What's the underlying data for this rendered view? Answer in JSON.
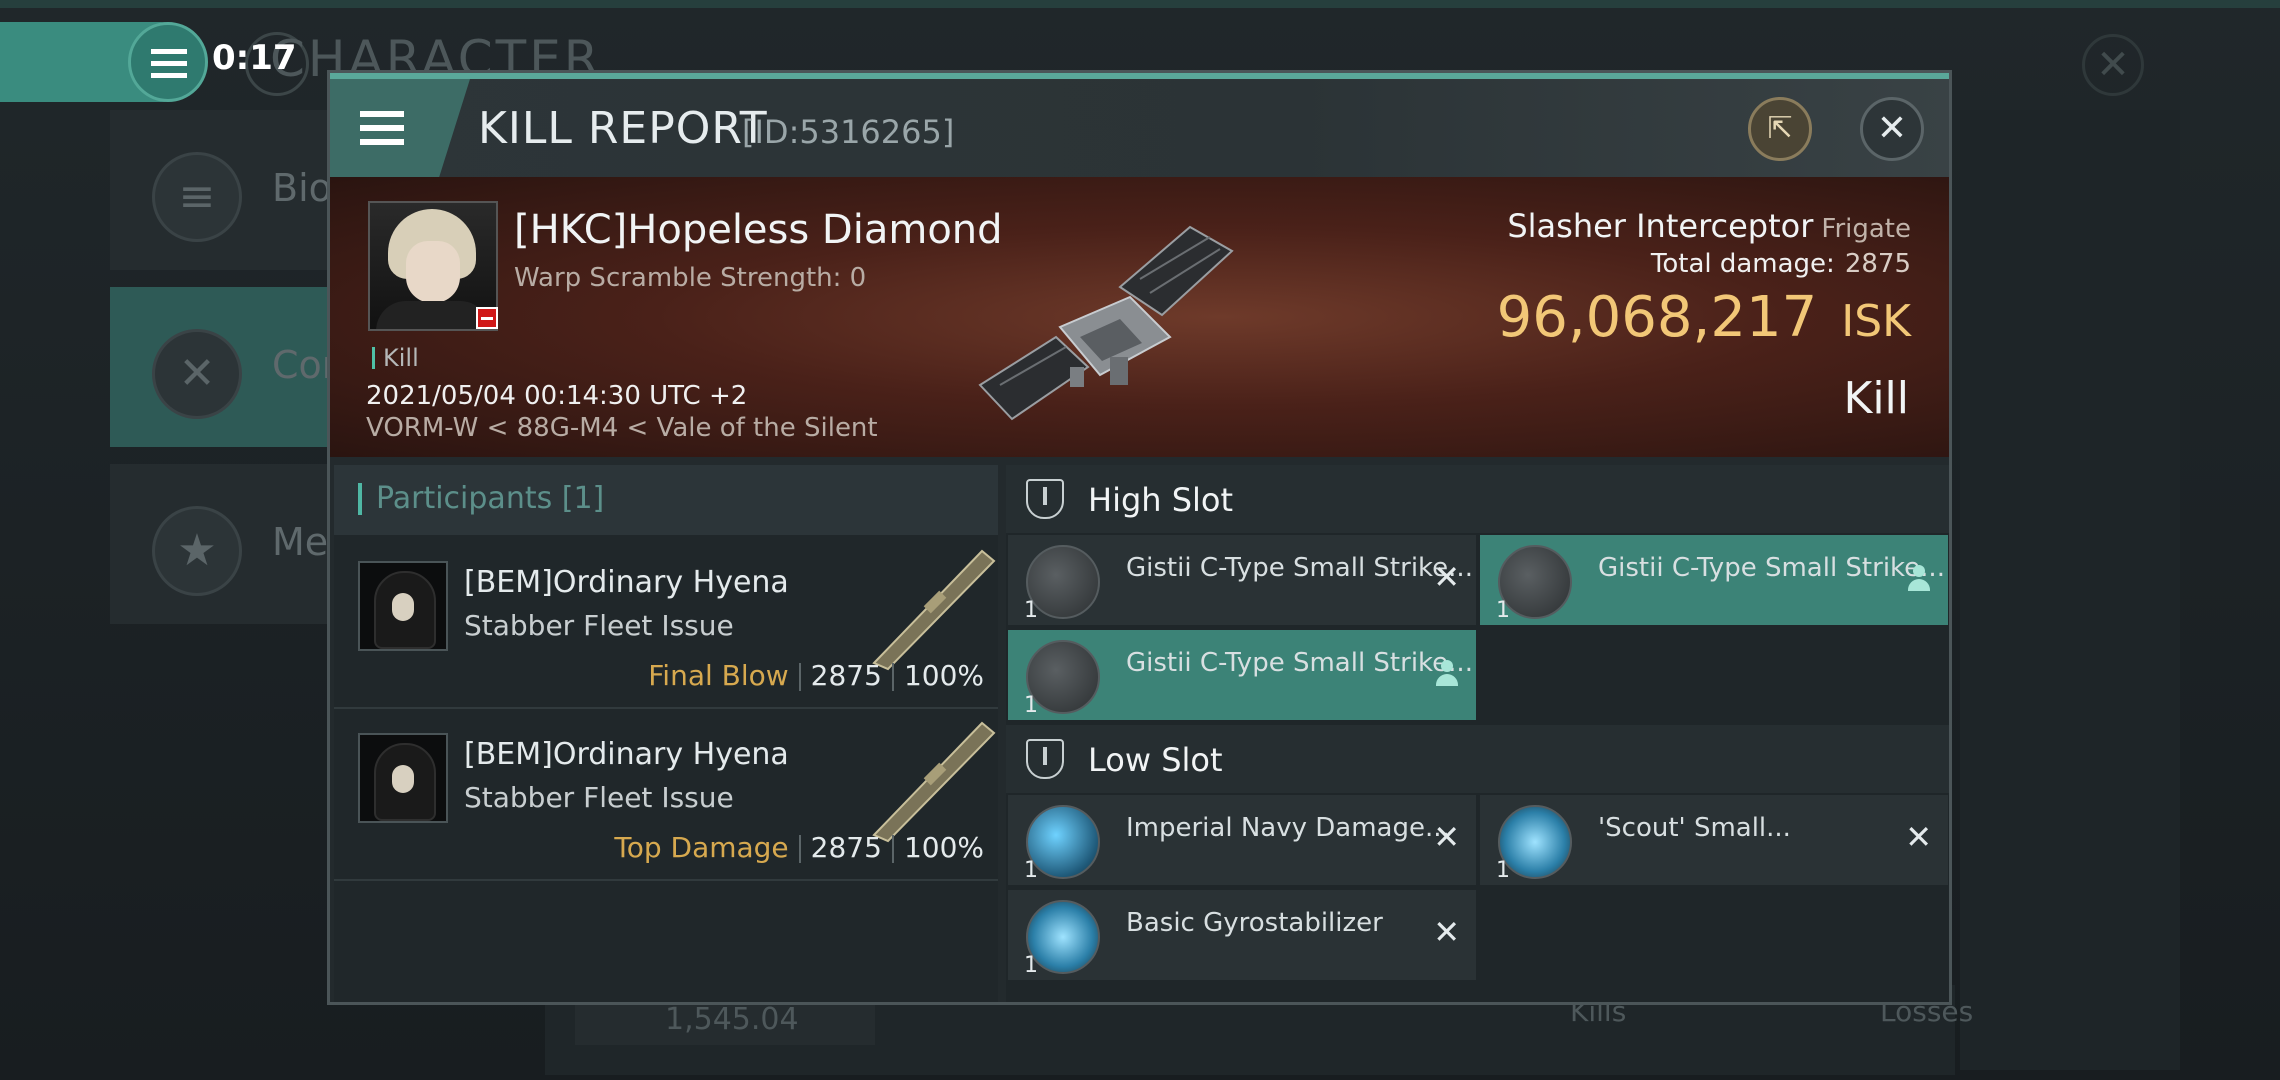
{
  "background": {
    "title": "CHARACTER",
    "sidebar": [
      {
        "label": "Bio",
        "icon": "menu-icon"
      },
      {
        "label": "Com",
        "icon": "crossed-swords-icon"
      },
      {
        "label": "Med",
        "icon": "star-icon"
      }
    ],
    "bottom_value": "1,545.04",
    "bottom_kills": "Kills",
    "bottom_losses": "Losses"
  },
  "timer": {
    "text": "0:17"
  },
  "report": {
    "title": "KILL REPORT",
    "id": "[ID:5316265]",
    "victim": {
      "name": "[HKC]Hopeless Diamond",
      "warp_scramble": "Warp Scramble Strength: 0",
      "kill_tag": "Kill",
      "datetime": "2021/05/04 00:14:30 UTC +2",
      "location": "VORM-W < 88G-M4 < Vale of the Silent"
    },
    "ship": {
      "name": "Slasher Interceptor",
      "class": "Frigate",
      "damage_label": "Total damage:",
      "damage_value": "2875",
      "isk_value": "96,068,217",
      "isk_unit": "ISK",
      "result": "Kill"
    },
    "participants": {
      "header": "Participants [1]",
      "rows": [
        {
          "name": "[BEM]Ordinary Hyena",
          "ship": "Stabber Fleet Issue",
          "tag": "Final Blow",
          "damage": "2875",
          "percent": "100%"
        },
        {
          "name": "[BEM]Ordinary Hyena",
          "ship": "Stabber Fleet Issue",
          "tag": "Top Damage",
          "damage": "2875",
          "percent": "100%"
        }
      ]
    },
    "fitting": {
      "high_slot_label": "High Slot",
      "high_slot": [
        {
          "name": "Gistii C-Type Small Strike...",
          "qty": "1",
          "state": "destroyed"
        },
        {
          "name": "Gistii C-Type Small Strike...",
          "qty": "1",
          "state": "dropped"
        },
        {
          "name": "Gistii C-Type Small Strike...",
          "qty": "1",
          "state": "dropped"
        }
      ],
      "low_slot_label": "Low Slot",
      "low_slot": [
        {
          "name": "Imperial Navy Damage...",
          "qty": "1",
          "state": "destroyed"
        },
        {
          "name": "'Scout' Small...",
          "qty": "1",
          "state": "destroyed"
        },
        {
          "name": "Basic Gyrostabilizer",
          "qty": "1",
          "state": "destroyed"
        }
      ]
    }
  },
  "colors": {
    "accent": "#3c8377",
    "isk": "#f2c777",
    "final_blow": "#d7a94f"
  }
}
